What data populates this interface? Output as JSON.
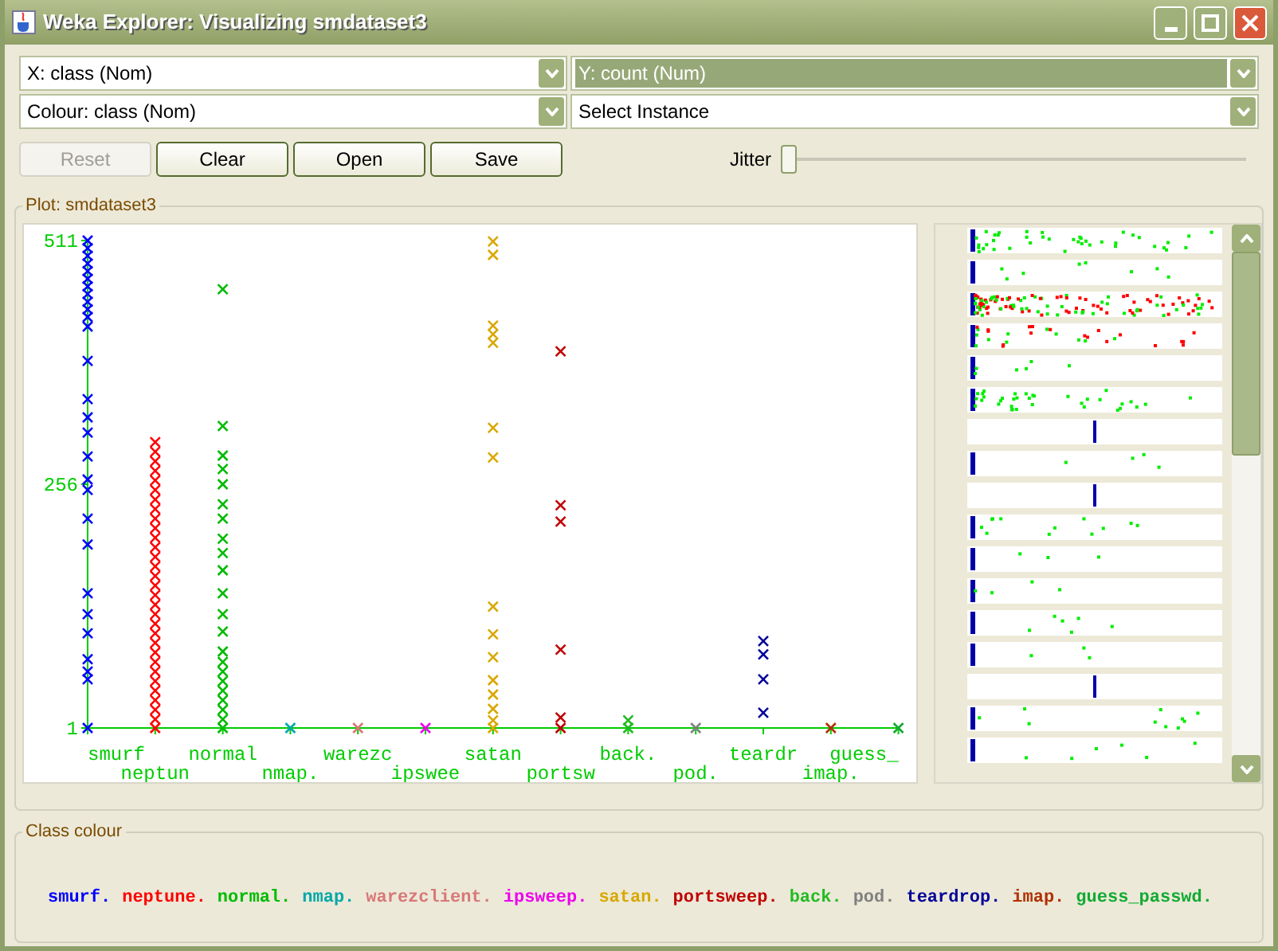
{
  "window": {
    "title": "Weka Explorer: Visualizing smdataset3"
  },
  "selectors": [
    {
      "value": "X: class (Nom)",
      "selected": false
    },
    {
      "value": "Y: count (Num)",
      "selected": true
    },
    {
      "value": "Colour: class (Nom)",
      "selected": false
    },
    {
      "value": "Select Instance",
      "selected": false
    }
  ],
  "buttons": [
    {
      "label": "Reset",
      "disabled": true
    },
    {
      "label": "Clear",
      "disabled": false
    },
    {
      "label": "Open",
      "disabled": false
    },
    {
      "label": "Save",
      "disabled": false
    }
  ],
  "jitter": {
    "label": "Jitter",
    "level": 0
  },
  "plot": {
    "title": "Plot: smdataset3",
    "y_tick_labels": [
      "511",
      "256",
      "1"
    ],
    "x_labels": [
      "smurf",
      "neptun",
      "normal",
      "nmap.",
      "warezc",
      "ipswee",
      "satan",
      "portsw",
      "back.",
      "pod.",
      "teardr",
      "imap.",
      "guess_"
    ]
  },
  "class_colour": {
    "title": "Class colour",
    "items": [
      {
        "name": "smurf.",
        "color": "#0000ff"
      },
      {
        "name": "neptune.",
        "color": "#ff0000"
      },
      {
        "name": "normal.",
        "color": "#00bb00"
      },
      {
        "name": "nmap.",
        "color": "#00a8a8"
      },
      {
        "name": "warezclient.",
        "color": "#d87878"
      },
      {
        "name": "ipsweep.",
        "color": "#ee00ee"
      },
      {
        "name": "satan.",
        "color": "#d8a800"
      },
      {
        "name": "portsweep.",
        "color": "#c00000"
      },
      {
        "name": "back.",
        "color": "#22bb22"
      },
      {
        "name": "pod.",
        "color": "#808080"
      },
      {
        "name": "teardrop.",
        "color": "#000099"
      },
      {
        "name": "imap.",
        "color": "#b03000"
      },
      {
        "name": "guess_passwd.",
        "color": "#11aa33"
      }
    ]
  }
}
